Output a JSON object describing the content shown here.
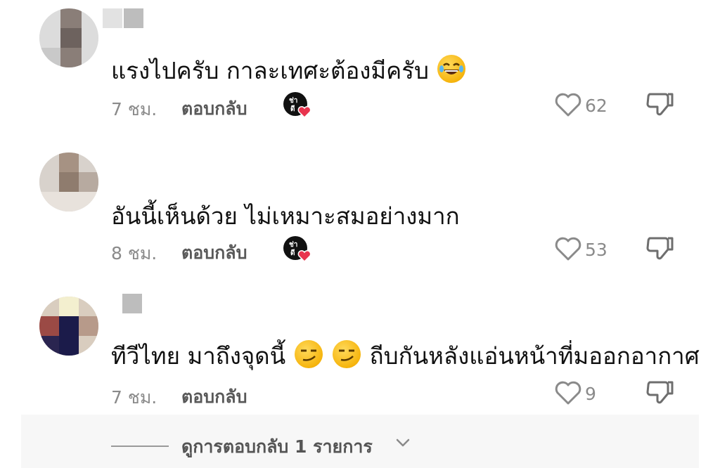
{
  "comments": [
    {
      "text": "แรงไปครับ กาละเทศะต้องมีครับ",
      "emoji": "😂",
      "time": "7 ชม.",
      "reply_label": "ตอบกลับ",
      "likes": "62"
    },
    {
      "text": "อันนี้เห็นด้วย ไม่เหมาะสมอย่างมาก",
      "time": "8 ชม.",
      "reply_label": "ตอบกลับ",
      "likes": "53"
    },
    {
      "text_before": "ทีวีไทย มาถึงจุดนี้",
      "emojis": "😏 😏",
      "text_after": "ถีบกันหลังแอ่นหน้าที่มออกอากาศ",
      "time": "7 ชม.",
      "reply_label": "ตอบกลับ",
      "likes": "9"
    }
  ],
  "view_replies": {
    "label": "ดูการตอบกลับ 1 รายการ"
  },
  "icons": {
    "like": "heart-outline-icon",
    "dislike": "thumbs-down-icon",
    "creator_liked": "creator-liked-badge",
    "chevron": "chevron-down-icon"
  },
  "colors": {
    "heart": "#e8344e",
    "muted": "#8a8a8a"
  }
}
